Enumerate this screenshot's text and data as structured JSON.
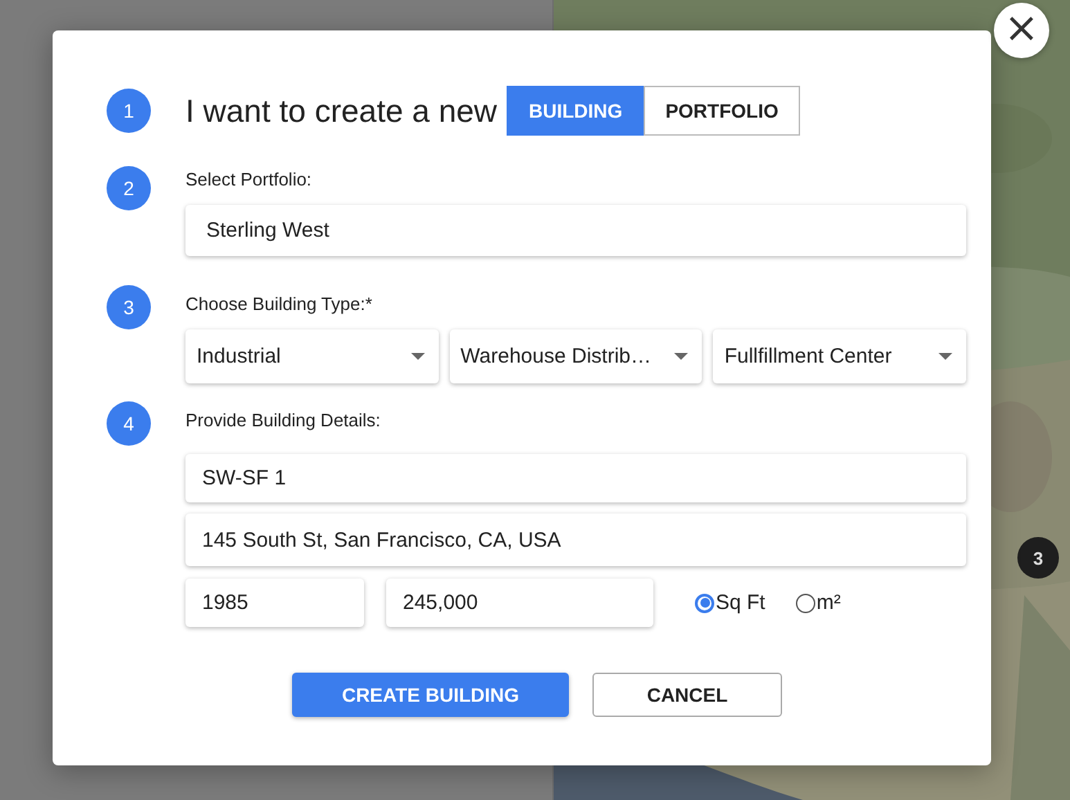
{
  "map_markers": [
    {
      "count": "3"
    }
  ],
  "dialog": {
    "close_label": "×",
    "steps": [
      {
        "number": "1",
        "kind": "choice",
        "text": "I want to create a new",
        "options": [
          {
            "label": "BUILDING",
            "selected": true
          },
          {
            "label": "PORTFOLIO",
            "selected": false
          }
        ]
      },
      {
        "number": "2",
        "kind": "field",
        "label": "Select Portfolio:",
        "value": "Sterling West"
      },
      {
        "number": "3",
        "kind": "selects",
        "label": "Choose Building Type:*",
        "selects": [
          {
            "value": "Industrial"
          },
          {
            "value": "Warehouse Distrib…"
          },
          {
            "value": "Fullfillment Center"
          }
        ]
      },
      {
        "number": "4",
        "kind": "details",
        "label": "Provide Building Details:",
        "name": "SW-SF 1",
        "address": "145 South St, San Francisco, CA, USA",
        "year": "1985",
        "area": "245,000",
        "units": [
          {
            "label": "Sq Ft",
            "selected": true
          },
          {
            "label": "m²",
            "selected": false
          }
        ]
      }
    ],
    "buttons": [
      {
        "label": "CREATE BUILDING",
        "kind": "primary"
      },
      {
        "label": "CANCEL",
        "kind": "secondary"
      }
    ]
  }
}
